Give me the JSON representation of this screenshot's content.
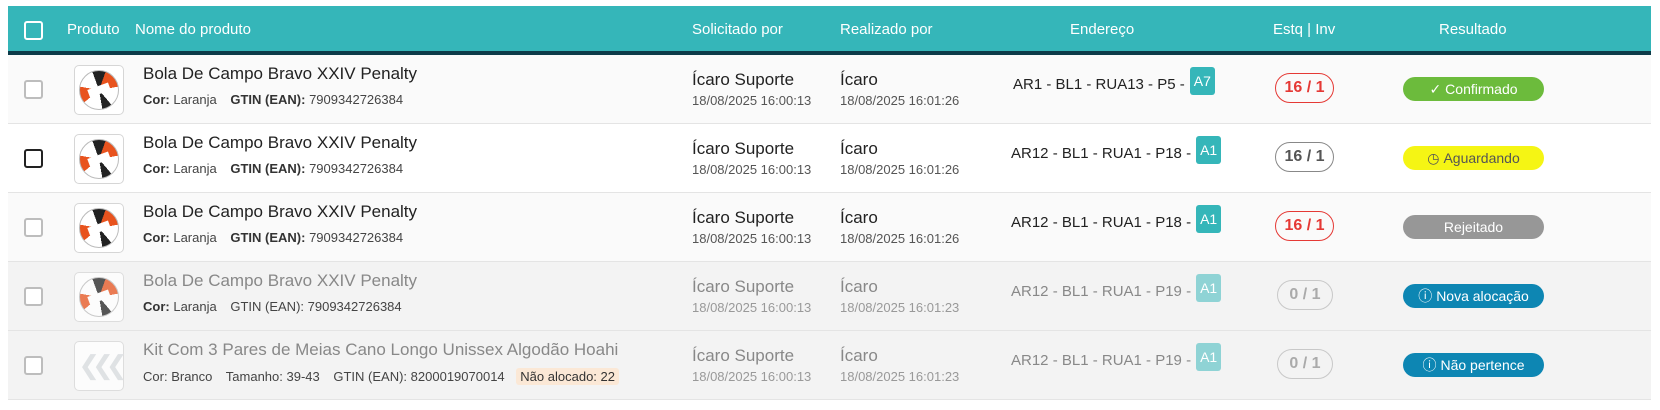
{
  "header": {
    "col_produto": "Produto",
    "col_nome": "Nome do produto",
    "col_solicitado": "Solicitado por",
    "col_realizado": "Realizado por",
    "col_endereco": "Endereço",
    "col_estoque": "Estq | Inv",
    "col_resultado": "Resultado"
  },
  "rows": [
    {
      "name": "Bola De Campo Bravo XXIV Penalty",
      "cor_label": "Cor:",
      "cor": "Laranja",
      "gtin_label": "GTIN (EAN):",
      "gtin": "7909342726384",
      "requested_by": "Ícaro Suporte",
      "requested_at": "18/08/2025 16:00:13",
      "done_by": "Ícaro",
      "done_at": "18/08/2025 16:01:26",
      "address": "AR1 - BL1 - RUA13 - P5 -",
      "address_tag": "A7",
      "stock": "16 / 1",
      "result": "Confirmado",
      "result_icon": "check-icon"
    },
    {
      "name": "Bola De Campo Bravo XXIV Penalty",
      "cor_label": "Cor:",
      "cor": "Laranja",
      "gtin_label": "GTIN (EAN):",
      "gtin": "7909342726384",
      "requested_by": "Ícaro Suporte",
      "requested_at": "18/08/2025 16:00:13",
      "done_by": "Ícaro",
      "done_at": "18/08/2025 16:01:26",
      "address": "AR12 - BL1 - RUA1 - P18 -",
      "address_tag": "A1",
      "stock": "16 / 1",
      "result": "Aguardando",
      "result_icon": "clock-icon"
    },
    {
      "name": "Bola De Campo Bravo XXIV Penalty",
      "cor_label": "Cor:",
      "cor": "Laranja",
      "gtin_label": "GTIN (EAN):",
      "gtin": "7909342726384",
      "requested_by": "Ícaro Suporte",
      "requested_at": "18/08/2025 16:00:13",
      "done_by": "Ícaro",
      "done_at": "18/08/2025 16:01:26",
      "address": "AR12 - BL1 - RUA1 - P18 -",
      "address_tag": "A1",
      "stock": "16 / 1",
      "result": "Rejeitado"
    },
    {
      "name": "Bola De Campo Bravo XXIV Penalty",
      "cor_label": "Cor:",
      "cor": "Laranja",
      "gtin_label": "GTIN (EAN):",
      "gtin": "7909342726384",
      "requested_by": "Ícaro Suporte",
      "requested_at": "18/08/2025 16:00:13",
      "done_by": "Ícaro",
      "done_at": "18/08/2025 16:01:23",
      "address": "AR12 - BL1 - RUA1 - P19 -",
      "address_tag": "A1",
      "stock": "0 / 1",
      "result": "Nova alocação",
      "result_icon": "info-icon"
    },
    {
      "name": "Kit Com 3 Pares de Meias Cano Longo Unissex Algodão Hoahi",
      "cor_label": "Cor:",
      "cor": "Branco",
      "size_label": "Tamanho:",
      "size": "39-43",
      "gtin_label": "GTIN (EAN):",
      "gtin": "8200019070014",
      "not_allocated_label": "Não alocado:",
      "not_allocated": "22",
      "requested_by": "Ícaro Suporte",
      "requested_at": "18/08/2025 16:00:13",
      "done_by": "Ícaro",
      "done_at": "18/08/2025 16:01:23",
      "address": "AR12 - BL1 - RUA1 - P19 -",
      "address_tag": "A1",
      "stock": "0 / 1",
      "result": "Não pertence",
      "result_icon": "info-icon"
    }
  ],
  "colors": {
    "header_bg": "#35b6b9",
    "confirmed": "#6cbb3c",
    "waiting": "#f5f514",
    "rejected": "#979797",
    "info": "#0d86b3",
    "stock_alert": "#e53935"
  }
}
